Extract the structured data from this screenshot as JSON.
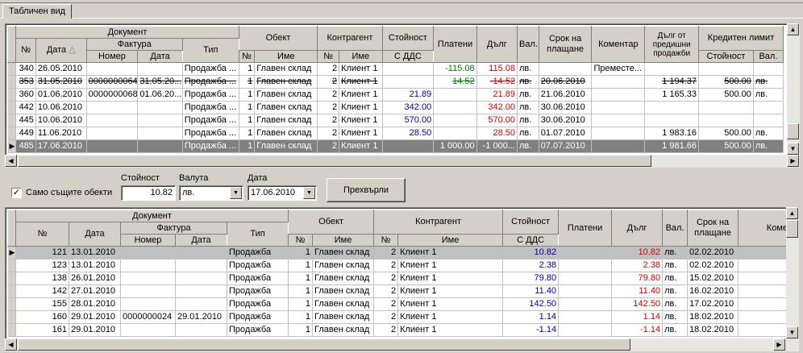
{
  "tab": {
    "label": "Табличен вид"
  },
  "top_grid": {
    "headers": {
      "doc": "Документ",
      "no": "№",
      "date": "Дата",
      "invoice": "Фактура",
      "inv_no": "Номер",
      "inv_date": "Дата",
      "type": "Тип",
      "object": "Обект",
      "obj_no": "№",
      "obj_name": "Име",
      "partner": "Контрагент",
      "par_no": "№",
      "par_name": "Име",
      "value": "Стойност",
      "value_vat": "С ДДС",
      "paid": "Платени",
      "debt": "Дълг",
      "cur": "Вал.",
      "term": "Срок на плащане",
      "comment": "Коментар",
      "prev_debt": "Дълг от предишни продажби",
      "credit": "Кредитен лимит",
      "credit_value": "Стойност",
      "credit_cur": "Вал."
    },
    "rows": [
      {
        "no": "340",
        "date": "26.05.2010",
        "inv_no": "",
        "inv_date": "",
        "type": "Продажба ...",
        "obj_no": "1",
        "obj_name": "Главен склад",
        "par_no": "2",
        "par_name": "Клиент 1",
        "value": "",
        "paid": "-115.08",
        "debt": "115.08",
        "cur": "лв.",
        "term": "",
        "comment": "Преместе...",
        "prev": "",
        "credit": "",
        "credit_cur": ""
      },
      {
        "no": "353",
        "date": "31.05.2010",
        "inv_no": "0000000064",
        "inv_date": "31.05.20...",
        "type": "Продажба ...",
        "obj_no": "1",
        "obj_name": "Главен склад",
        "par_no": "2",
        "par_name": "Клиент 1",
        "value": "",
        "paid": "14.52",
        "debt": "-14.52",
        "cur": "лв.",
        "term": "20.06.2010",
        "comment": "",
        "prev": "1 194.37",
        "credit": "500.00",
        "credit_cur": "лв."
      },
      {
        "no": "360",
        "date": "01.06.2010",
        "inv_no": "0000000068",
        "inv_date": "01.06.20...",
        "type": "Продажба ...",
        "obj_no": "1",
        "obj_name": "Главен склад",
        "par_no": "2",
        "par_name": "Клиент 1",
        "value": "21.89",
        "paid": "",
        "debt": "21.89",
        "cur": "лв.",
        "term": "21.06.2010",
        "comment": "",
        "prev": "1 165.33",
        "credit": "500.00",
        "credit_cur": "лв."
      },
      {
        "no": "442",
        "date": "10.06.2010",
        "inv_no": "",
        "inv_date": "",
        "type": "Продажба ...",
        "obj_no": "1",
        "obj_name": "Главен склад",
        "par_no": "2",
        "par_name": "Клиент 1",
        "value": "342.00",
        "paid": "",
        "debt": "342.00",
        "cur": "лв.",
        "term": "30.06.2010",
        "comment": "",
        "prev": "",
        "credit": "",
        "credit_cur": ""
      },
      {
        "no": "445",
        "date": "10.06.2010",
        "inv_no": "",
        "inv_date": "",
        "type": "Продажба ...",
        "obj_no": "1",
        "obj_name": "Главен склад",
        "par_no": "2",
        "par_name": "Клиент 1",
        "value": "570.00",
        "paid": "",
        "debt": "570.00",
        "cur": "лв.",
        "term": "30.06.2010",
        "comment": "",
        "prev": "",
        "credit": "",
        "credit_cur": ""
      },
      {
        "no": "449",
        "date": "11.06.2010",
        "inv_no": "",
        "inv_date": "",
        "type": "Продажба ...",
        "obj_no": "1",
        "obj_name": "Главен склад",
        "par_no": "2",
        "par_name": "Клиент 1",
        "value": "28.50",
        "paid": "",
        "debt": "28.50",
        "cur": "лв.",
        "term": "01.07.2010",
        "comment": "",
        "prev": "1 983.16",
        "credit": "500.00",
        "credit_cur": "лв."
      },
      {
        "no": "485",
        "date": "17.06.2010",
        "inv_no": "",
        "inv_date": "",
        "type": "Продажба ...",
        "obj_no": "1",
        "obj_name": "Главен склад",
        "par_no": "2",
        "par_name": "Клиент 1",
        "value": "",
        "paid": "1 000.00",
        "debt": "-1 000...",
        "cur": "лв.",
        "term": "07.07.2010",
        "comment": "",
        "prev": "1 981.66",
        "credit": "500.00",
        "credit_cur": "лв."
      }
    ]
  },
  "controls": {
    "checkbox_label": "Само същите обекти",
    "value_label": "Стойност",
    "value": "10.82",
    "currency_label": "Валута",
    "currency": "лв.",
    "date_label": "Дата",
    "date": "17.06.2010",
    "transfer_button": "Прехвърли"
  },
  "bottom_grid": {
    "headers": {
      "doc": "Документ",
      "no": "№",
      "date": "Дата",
      "invoice": "Фактура",
      "inv_no": "Номер",
      "inv_date": "Дата",
      "type": "Тип",
      "object": "Обект",
      "obj_no": "№",
      "obj_name": "Име",
      "partner": "Контрагент",
      "par_no": "№",
      "par_name": "Име",
      "value": "Стойност",
      "value_vat": "С ДДС",
      "paid": "Платени",
      "debt": "Дълг",
      "cur": "Вал.",
      "term": "Срок на плащане",
      "comment": "Комен"
    },
    "rows": [
      {
        "no": "121",
        "date": "13.01.2010",
        "inv_no": "",
        "inv_date": "",
        "type": "Продажба",
        "obj_no": "1",
        "obj_name": "Главен склад",
        "par_no": "2",
        "par_name": "Клиент 1",
        "value": "10.82",
        "paid": "",
        "debt": "10.82",
        "cur": "лв.",
        "term": "02.02.2010"
      },
      {
        "no": "123",
        "date": "13.01.2010",
        "inv_no": "",
        "inv_date": "",
        "type": "Продажба",
        "obj_no": "1",
        "obj_name": "Главен склад",
        "par_no": "2",
        "par_name": "Клиент 1",
        "value": "2.38",
        "paid": "",
        "debt": "2.38",
        "cur": "лв.",
        "term": "02.02.2010"
      },
      {
        "no": "138",
        "date": "26.01.2010",
        "inv_no": "",
        "inv_date": "",
        "type": "Продажба",
        "obj_no": "1",
        "obj_name": "Главен склад",
        "par_no": "2",
        "par_name": "Клиент 1",
        "value": "79.80",
        "paid": "",
        "debt": "79.80",
        "cur": "лв.",
        "term": "15.02.2010"
      },
      {
        "no": "142",
        "date": "27.01.2010",
        "inv_no": "",
        "inv_date": "",
        "type": "Продажба",
        "obj_no": "1",
        "obj_name": "Главен склад",
        "par_no": "2",
        "par_name": "Клиент 1",
        "value": "11.40",
        "paid": "",
        "debt": "11.40",
        "cur": "лв.",
        "term": "16.02.2010"
      },
      {
        "no": "155",
        "date": "28.01.2010",
        "inv_no": "",
        "inv_date": "",
        "type": "Продажба",
        "obj_no": "1",
        "obj_name": "Главен склад",
        "par_no": "2",
        "par_name": "Клиент 1",
        "value": "142.50",
        "paid": "",
        "debt": "142.50",
        "cur": "лв.",
        "term": "17.02.2010"
      },
      {
        "no": "160",
        "date": "29.01.2010",
        "inv_no": "0000000024",
        "inv_date": "29.01.2010",
        "type": "Продажба",
        "obj_no": "1",
        "obj_name": "Главен склад",
        "par_no": "2",
        "par_name": "Клиент 1",
        "value": "1.14",
        "paid": "",
        "debt": "1.14",
        "cur": "лв.",
        "term": "18.02.2010"
      },
      {
        "no": "161",
        "date": "29.01.2010",
        "inv_no": "",
        "inv_date": "",
        "type": "Продажба",
        "obj_no": "1",
        "obj_name": "Главен склад",
        "par_no": "2",
        "par_name": "Клиент 1",
        "value": "-1.14",
        "paid": "",
        "debt": "-1.14",
        "cur": "лв.",
        "term": "18.02.2010"
      }
    ]
  }
}
